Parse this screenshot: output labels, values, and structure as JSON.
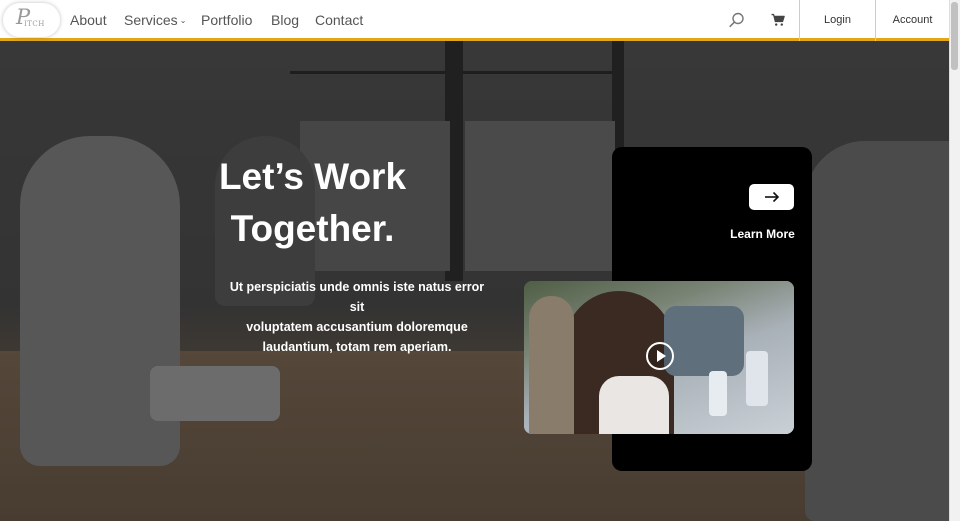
{
  "nav": {
    "logo_mark": "P",
    "logo_text": "ITCH",
    "items": [
      "About",
      "Services",
      "Portfolio",
      "Blog",
      "Contact"
    ],
    "services_chevron": "⌄",
    "login_label": "Login",
    "account_label": "Account"
  },
  "hero": {
    "headline_line1": "Let’s Work",
    "headline_line2": "Together.",
    "subtext_line1": "Ut perspiciatis unde omnis iste natus error sit",
    "subtext_line2": "voluptatem accusantium doloremque",
    "subtext_line3": "laudantium, totam rem aperiam.",
    "learn_more_label": "Learn More"
  },
  "colors": {
    "accent": "#e3a51a",
    "card_bg": "#000000",
    "text_light": "#ffffff"
  },
  "icons": {
    "search": "search-icon",
    "cart": "cart-icon",
    "arrow": "arrow-right-icon",
    "play": "play-icon"
  }
}
